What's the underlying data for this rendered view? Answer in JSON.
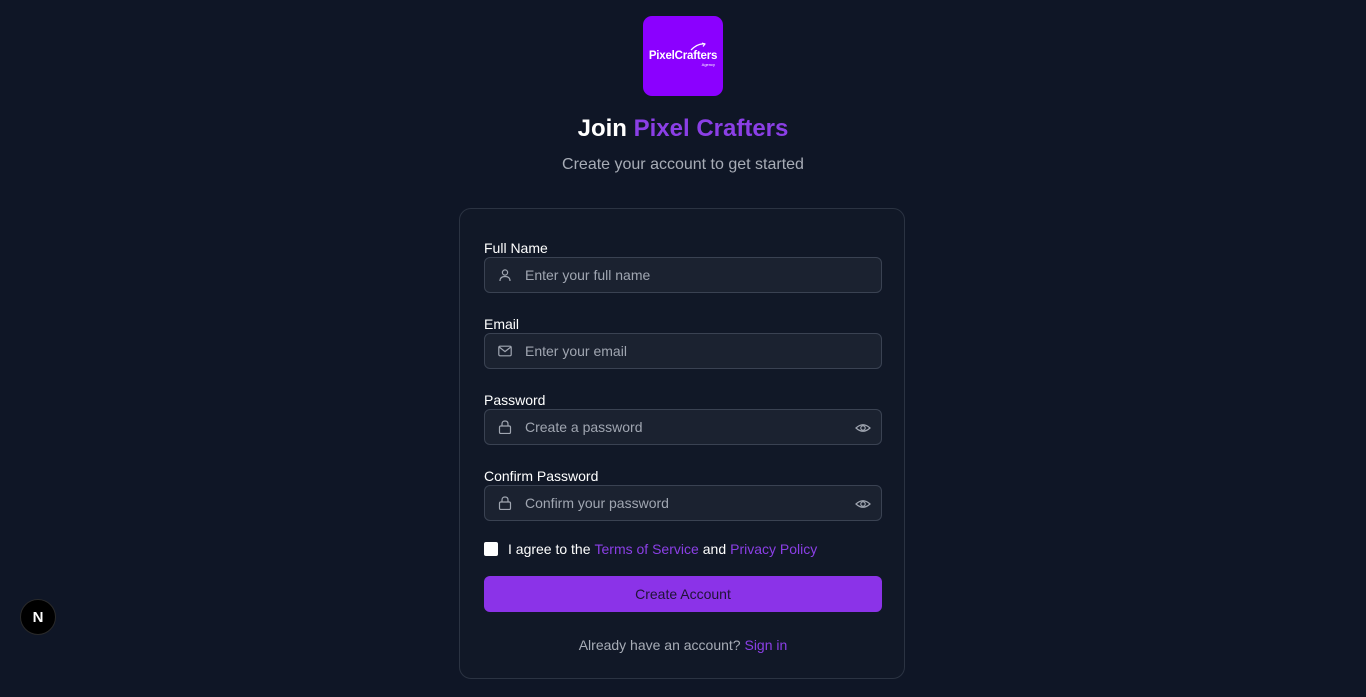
{
  "brand": {
    "logo_text": "PixelCrafters",
    "logo_sub": "Agency",
    "logo_color": "#8b00ff",
    "accent_color": "#8b3fe6"
  },
  "heading": {
    "prefix": "Join",
    "brand_name": "Pixel Crafters",
    "subtitle": "Create your account to get started"
  },
  "form": {
    "full_name": {
      "label": "Full Name",
      "placeholder": "Enter your full name",
      "icon": "user-icon"
    },
    "email": {
      "label": "Email",
      "placeholder": "Enter your email",
      "icon": "mail-icon"
    },
    "password": {
      "label": "Password",
      "placeholder": "Create a password",
      "icon": "lock-icon",
      "toggle_icon": "eye-icon"
    },
    "confirm_password": {
      "label": "Confirm Password",
      "placeholder": "Confirm your password",
      "icon": "lock-icon",
      "toggle_icon": "eye-icon"
    },
    "agree": {
      "prefix": "I agree to the",
      "terms_link": "Terms of Service",
      "conjunction": "and",
      "privacy_link": "Privacy Policy"
    },
    "submit_label": "Create Account",
    "signin": {
      "prompt": "Already have an account?",
      "link": "Sign in"
    }
  },
  "dev_badge": {
    "letter": "N"
  }
}
